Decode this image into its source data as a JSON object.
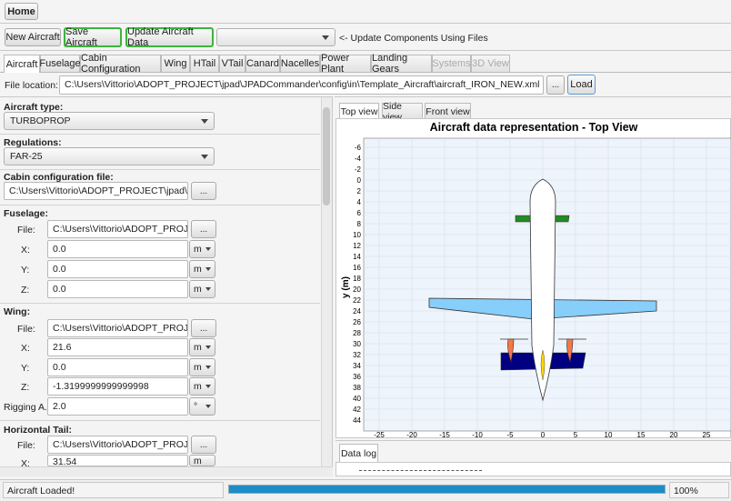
{
  "toolbar": {
    "home": "Home",
    "new_aircraft": "New Aircraft",
    "save_aircraft": "Save Aircraft",
    "update_aircraft_data": "Update Aircraft Data",
    "update_hint": "<- Update Components Using Files"
  },
  "tabs": [
    "Aircraft",
    "Fuselage",
    "Cabin Configuration",
    "Wing",
    "HTail",
    "VTail",
    "Canard",
    "Nacelles",
    "Power Plant",
    "Landing Gears",
    "Systems",
    "3D View"
  ],
  "file_location": {
    "label": "File location:",
    "value": "C:\\Users\\Vittorio\\ADOPT_PROJECT\\jpad\\JPADCommander\\config\\in\\Template_Aircraft\\aircraft_IRON_NEW.xml",
    "browse": "...",
    "load": "Load"
  },
  "form": {
    "aircraft_type_label": "Aircraft type:",
    "aircraft_type": "TURBOPROP",
    "regulations_label": "Regulations:",
    "regulations": "FAR-25",
    "cabin_label": "Cabin configuration file:",
    "cabin_file": "C:\\Users\\Vittorio\\ADOPT_PROJECT\\jpad\\JPADCo",
    "fuselage_label": "Fuselage:",
    "fuselage_file": "C:\\Users\\Vittorio\\ADOPT_PROJECT\\jp",
    "fuselage_x": "0.0",
    "fuselage_y": "0.0",
    "fuselage_z": "0.0",
    "wing_label": "Wing:",
    "wing_file": "C:\\Users\\Vittorio\\ADOPT_PROJECT\\jp",
    "wing_x": "21.6",
    "wing_y": "0.0",
    "wing_z": "-1.3199999999999998",
    "wing_rigging": "2.0",
    "htail_label": "Horizontal Tail:",
    "htail_file": "C:\\Users\\Vittorio\\ADOPT_PROJECT\\jp",
    "htail_x": "31.54",
    "file_lbl": "File:",
    "x_lbl": "X:",
    "y_lbl": "Y:",
    "z_lbl": "Z:",
    "rigging_lbl": "Rigging A...",
    "unit_m": "m",
    "unit_deg": "°",
    "browse": "..."
  },
  "view_tabs": [
    "Top view",
    "Side view",
    "Front view"
  ],
  "chart_data": {
    "type": "diagram",
    "title": "Aircraft data representation - Top View",
    "ylabel": "y (m)",
    "y_ticks": [
      -6,
      -4,
      -2,
      0,
      2,
      4,
      6,
      8,
      10,
      12,
      14,
      16,
      18,
      20,
      22,
      24,
      26,
      28,
      30,
      32,
      34,
      36,
      38,
      40,
      42,
      44
    ],
    "x_ticks": [
      -25,
      -20,
      -15,
      -10,
      -5,
      0,
      5,
      10,
      15,
      20,
      25
    ],
    "colors": {
      "fuselage": "#ffffff",
      "wing": "#87cefa",
      "htail": "#228b22",
      "nacelles": "#f4764a",
      "landing_gear": "#000080",
      "vtail": "#ffd700"
    }
  },
  "data_log": {
    "tab": "Data log"
  },
  "status": {
    "text": "Aircraft Loaded!",
    "progress": 1.0,
    "percent": "100%"
  }
}
